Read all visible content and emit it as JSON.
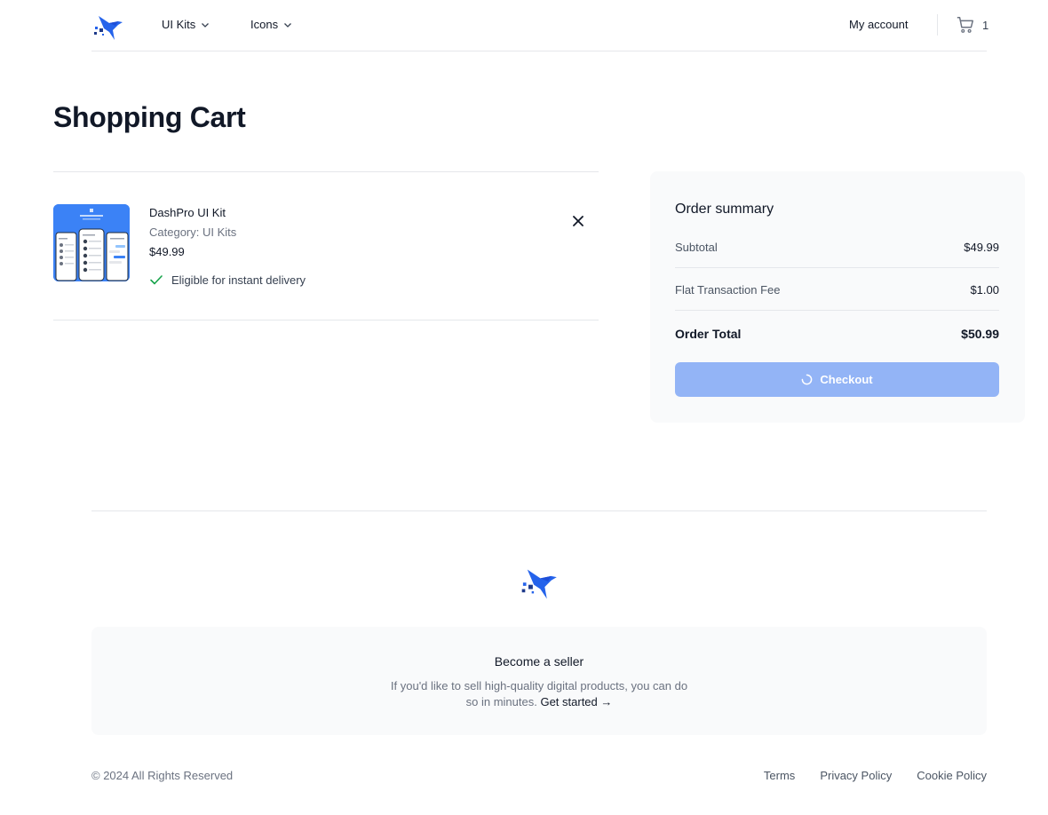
{
  "header": {
    "nav": [
      {
        "label": "UI Kits",
        "icon": "chevron-down-icon"
      },
      {
        "label": "Icons",
        "icon": "chevron-down-icon"
      }
    ],
    "account_label": "My account",
    "cart_count": "1"
  },
  "page": {
    "title": "Shopping Cart"
  },
  "cart": {
    "items": [
      {
        "name": "DashPro UI Kit",
        "category": "Category: UI Kits",
        "price": "$49.99",
        "delivery": "Eligible for instant delivery"
      }
    ]
  },
  "summary": {
    "title": "Order summary",
    "subtotal_label": "Subtotal",
    "subtotal_value": "$49.99",
    "fee_label": "Flat Transaction Fee",
    "fee_value": "$1.00",
    "total_label": "Order Total",
    "total_value": "$50.99",
    "checkout_label": "Checkout"
  },
  "footer": {
    "seller_title": "Become a seller",
    "seller_text": "If you'd like to sell high-quality digital products, you can do so in minutes.",
    "seller_link": "Get started →",
    "copyright": "© 2024 All Rights Reserved",
    "links": [
      "Terms",
      "Privacy Policy",
      "Cookie Policy"
    ]
  },
  "colors": {
    "brand": "#2563eb",
    "checkout_disabled": "#93b4f6",
    "success": "#16a34a",
    "panel_bg": "#f9fafb"
  }
}
